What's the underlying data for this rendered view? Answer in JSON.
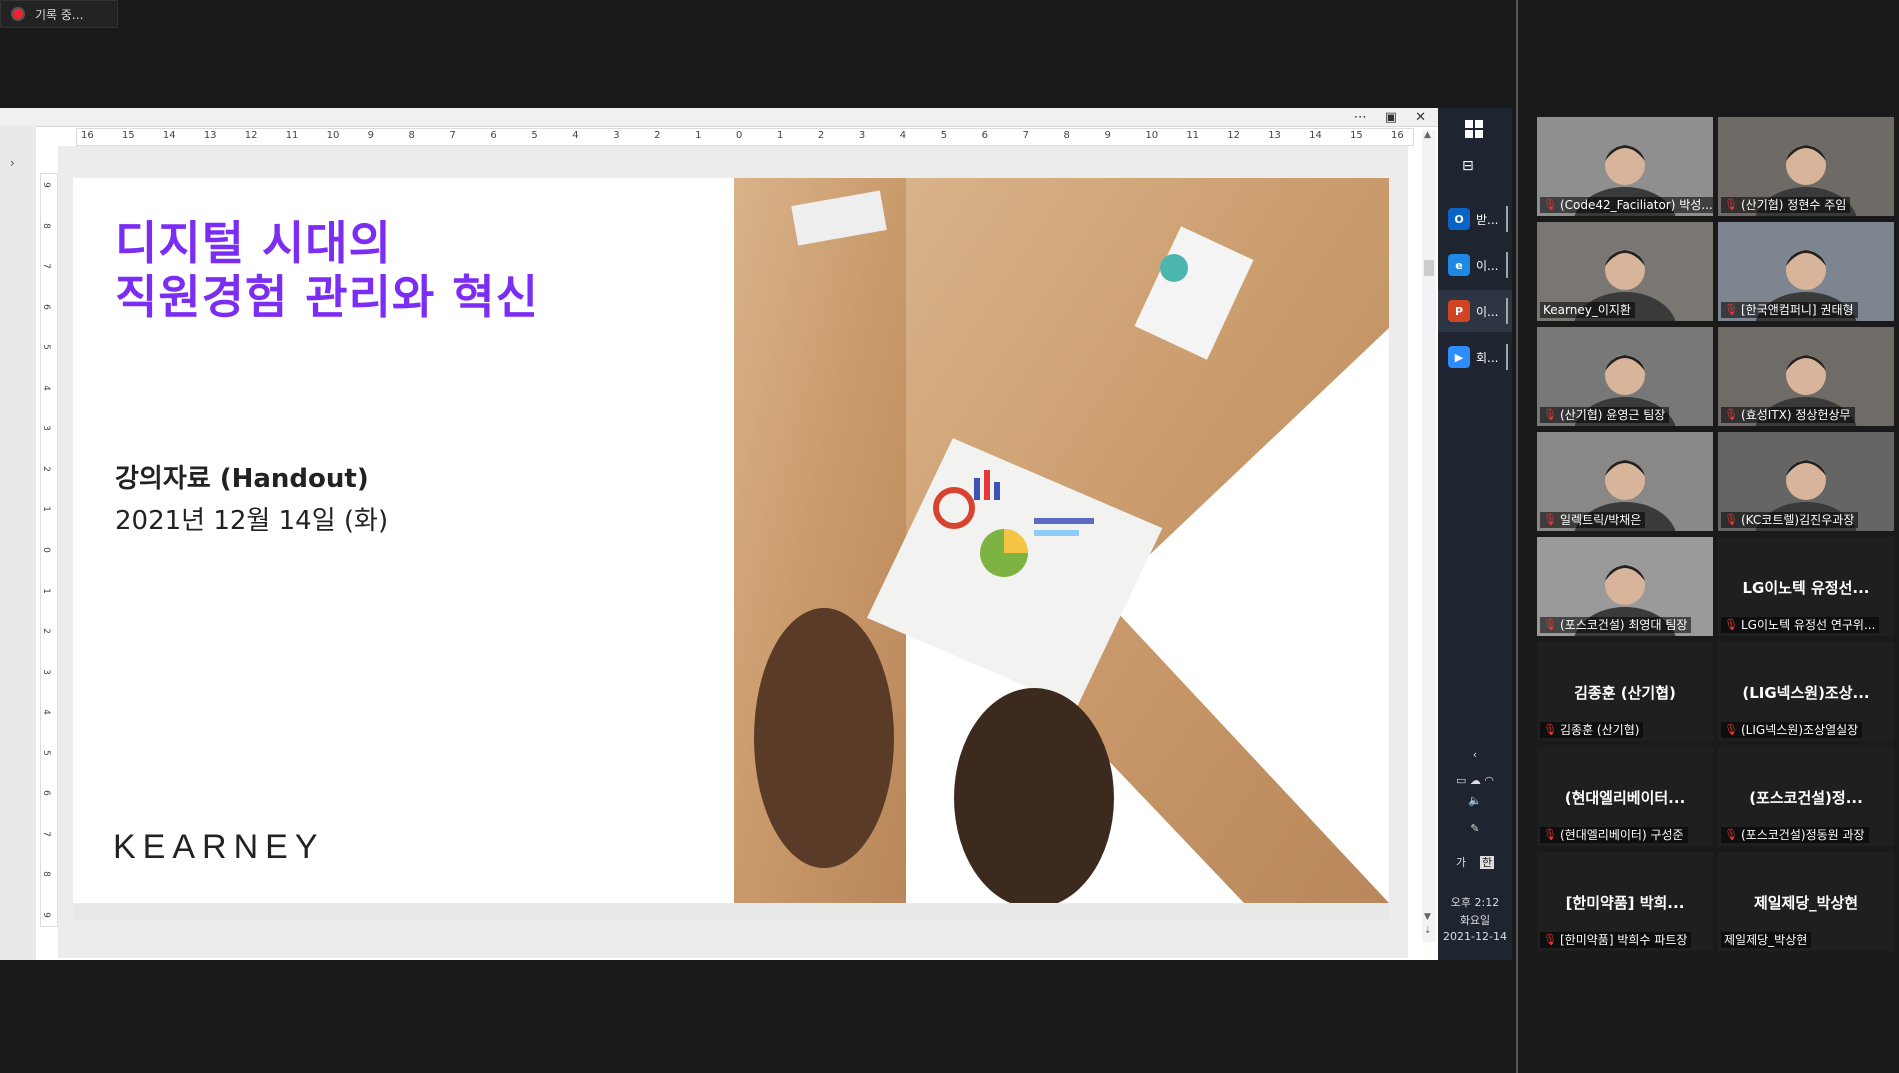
{
  "recording": {
    "label": "기록 중..."
  },
  "slide": {
    "title_line1": "디지털 시대의",
    "title_line2": "직원경험 관리와 혁신",
    "handout": "강의자료 (Handout)",
    "date": "2021년 12월 14일 (화)",
    "logo": "KEARNEY"
  },
  "ruler": {
    "h": [
      "16",
      "15",
      "14",
      "13",
      "12",
      "11",
      "10",
      "9",
      "8",
      "7",
      "6",
      "5",
      "4",
      "3",
      "2",
      "1",
      "0",
      "1",
      "2",
      "3",
      "4",
      "5",
      "6",
      "7",
      "8",
      "9",
      "10",
      "11",
      "12",
      "13",
      "14",
      "15",
      "16"
    ],
    "v": [
      "9",
      "8",
      "7",
      "6",
      "5",
      "4",
      "3",
      "2",
      "1",
      "0",
      "1",
      "2",
      "3",
      "4",
      "5",
      "6",
      "7",
      "8",
      "9"
    ]
  },
  "taskbar": {
    "apps": [
      {
        "icon": "outlook-icon",
        "label": "받...",
        "color": "#0a64c8",
        "glyph": "O"
      },
      {
        "icon": "ie-icon",
        "label": "이...",
        "color": "#1e88e5",
        "glyph": "e"
      },
      {
        "icon": "powerpoint-icon",
        "label": "이...",
        "color": "#d04423",
        "glyph": "P"
      },
      {
        "icon": "zoom-icon",
        "label": "회...",
        "color": "#2d8cff",
        "glyph": "▶"
      }
    ],
    "ime": "가",
    "ime2": "한",
    "time": "오후 2:12",
    "day": "화요일",
    "date": "2021-12-14"
  },
  "participants": [
    {
      "name": "(Code42_Faciliator) 박성...",
      "video": true,
      "muted": true,
      "bg": "#8f8f8f"
    },
    {
      "name": "(산기협) 정현수 주임",
      "video": true,
      "muted": true,
      "bg": "#6e6a66"
    },
    {
      "name": "Kearney_이지환",
      "video": true,
      "muted": false,
      "active": true,
      "bg": "#7a7772"
    },
    {
      "name": "[한국앤컴퍼니] 권태형",
      "video": true,
      "muted": true,
      "bg": "#7d8590"
    },
    {
      "name": "(산기협) 윤영근 팀장",
      "video": true,
      "muted": true,
      "bg": "#787878"
    },
    {
      "name": "(효성ITX) 정상헌상무",
      "video": true,
      "muted": true,
      "bg": "#6f6c67"
    },
    {
      "name": "일렉트릭/박채은",
      "video": true,
      "muted": true,
      "bg": "#8a8886"
    },
    {
      "name": "(KC코트렐)김진우과장",
      "video": true,
      "muted": true,
      "bg": "#656565"
    },
    {
      "name": "(포스코건설) 최영대 팀장",
      "video": true,
      "muted": true,
      "bg": "#9a9a9a"
    },
    {
      "name": "LG이노텍 유정선 연구위...",
      "center": "LG이노텍 유정선...",
      "video": false,
      "muted": true
    },
    {
      "name": "김종훈 (산기협)",
      "center": "김종훈 (산기협)",
      "video": false,
      "muted": true
    },
    {
      "name": "(LIG넥스원)조상열실장",
      "center": "(LIG넥스원)조상...",
      "video": false,
      "muted": true
    },
    {
      "name": "(현대엘리베이터) 구성준",
      "center": "(현대엘리베이터...",
      "video": false,
      "muted": true
    },
    {
      "name": "(포스코건설)정동원 과장",
      "center": "(포스코건설)정...",
      "video": false,
      "muted": true
    },
    {
      "name": "[한미약품] 박희수 파트장",
      "center": "[한미약품] 박희...",
      "video": false,
      "muted": true
    },
    {
      "name": "제일제당_박상현",
      "center": "제일제당_박상현",
      "video": false,
      "muted": false
    }
  ]
}
